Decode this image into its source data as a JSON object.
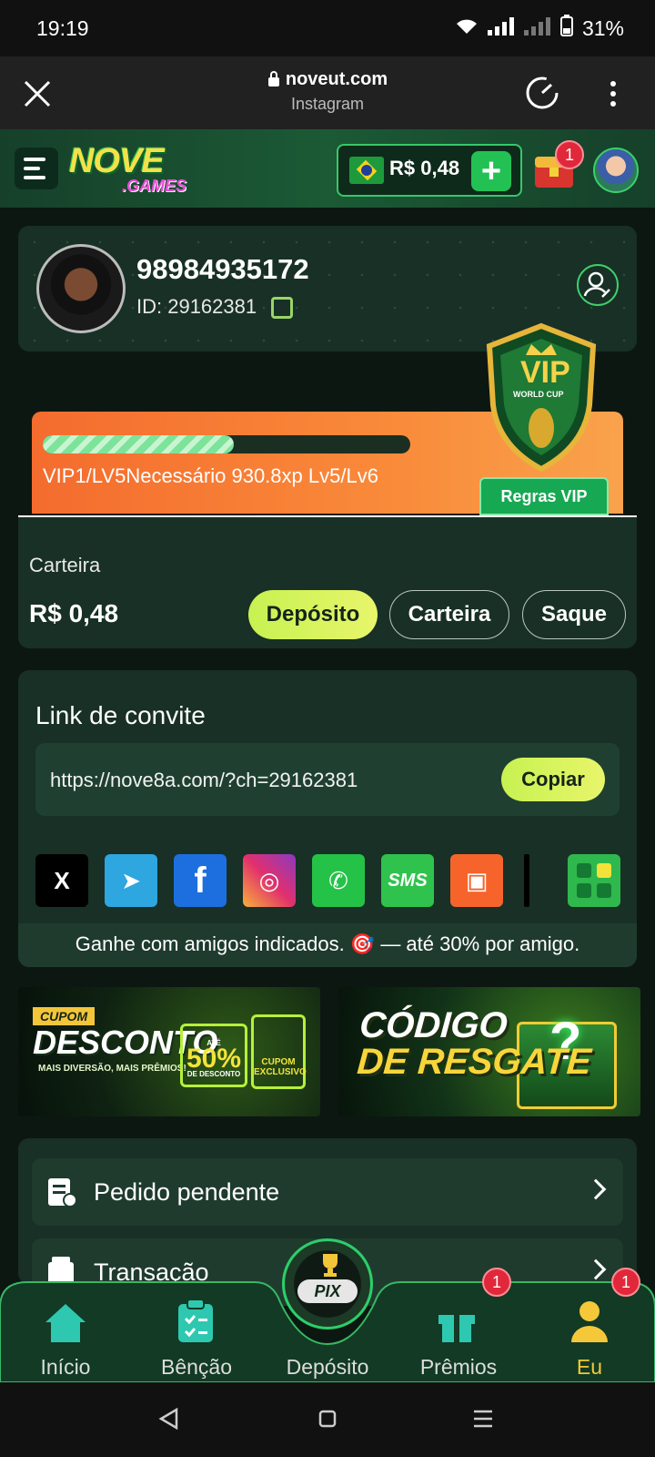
{
  "status_bar": {
    "time": "19:19",
    "battery": "31%"
  },
  "browser": {
    "url": "noveut.com",
    "source": "Instagram"
  },
  "header": {
    "logo_main": "NOVE",
    "logo_sub": ".GAMES",
    "balance": "R$ 0,48",
    "gift_badge": "1"
  },
  "profile": {
    "username": "98984935172",
    "id_label": "ID: 29162381"
  },
  "vip": {
    "progress_fraction": 0.52,
    "status_text": "VIP1/LV5Necessário 930.8xp Lv5/Lv6",
    "rules_button": "Regras VIP",
    "shield_title": "VIP",
    "shield_subtitle": "WORLD CUP"
  },
  "wallet": {
    "label": "Carteira",
    "amount": "R$ 0,48",
    "buttons": {
      "deposit": "Depósito",
      "wallet": "Carteira",
      "withdraw": "Saque"
    }
  },
  "invite": {
    "title": "Link de convite",
    "link": "https://nove8a.com/?ch=29162381",
    "copy_button": "Copiar",
    "social": [
      {
        "name": "x",
        "glyph": "X"
      },
      {
        "name": "telegram",
        "glyph": "➤"
      },
      {
        "name": "facebook",
        "glyph": "f"
      },
      {
        "name": "instagram",
        "glyph": "◎"
      },
      {
        "name": "whatsapp",
        "glyph": "✆"
      },
      {
        "name": "sms",
        "glyph": "SMS"
      },
      {
        "name": "kwai",
        "glyph": "▣"
      }
    ],
    "footer": "Ganhe com amigos indicados. 🎯 — até 30% por amigo."
  },
  "banners": {
    "coupon": {
      "tag": "CUPOM",
      "title": "DESCONTO",
      "subtitle": "MAIS DIVERSÃO, MAIS PRÊMIOS!",
      "percent": "50%",
      "percent_prefix": "ATÉ",
      "percent_suffix": "DE DESCONTO",
      "ticket": "CUPOM EXCLUSIVO"
    },
    "redeem": {
      "line1": "CÓDIGO",
      "line2": "DE RESGATE",
      "mark": "?"
    }
  },
  "menu": {
    "items": [
      {
        "label": "Pedido pendente"
      },
      {
        "label": "Transação"
      }
    ]
  },
  "bottom_nav": {
    "items": [
      {
        "label": "Início"
      },
      {
        "label": "Bênção"
      },
      {
        "label": "Depósito"
      },
      {
        "label": "Prêmios",
        "badge": "1"
      },
      {
        "label": "Eu",
        "badge": "1"
      }
    ],
    "pix_label": "PIX"
  },
  "colors": {
    "accent_green": "#23c154",
    "lime": "#c7f251",
    "active_nav": "#f5c83a",
    "vip_orange": "#f46c2e"
  }
}
